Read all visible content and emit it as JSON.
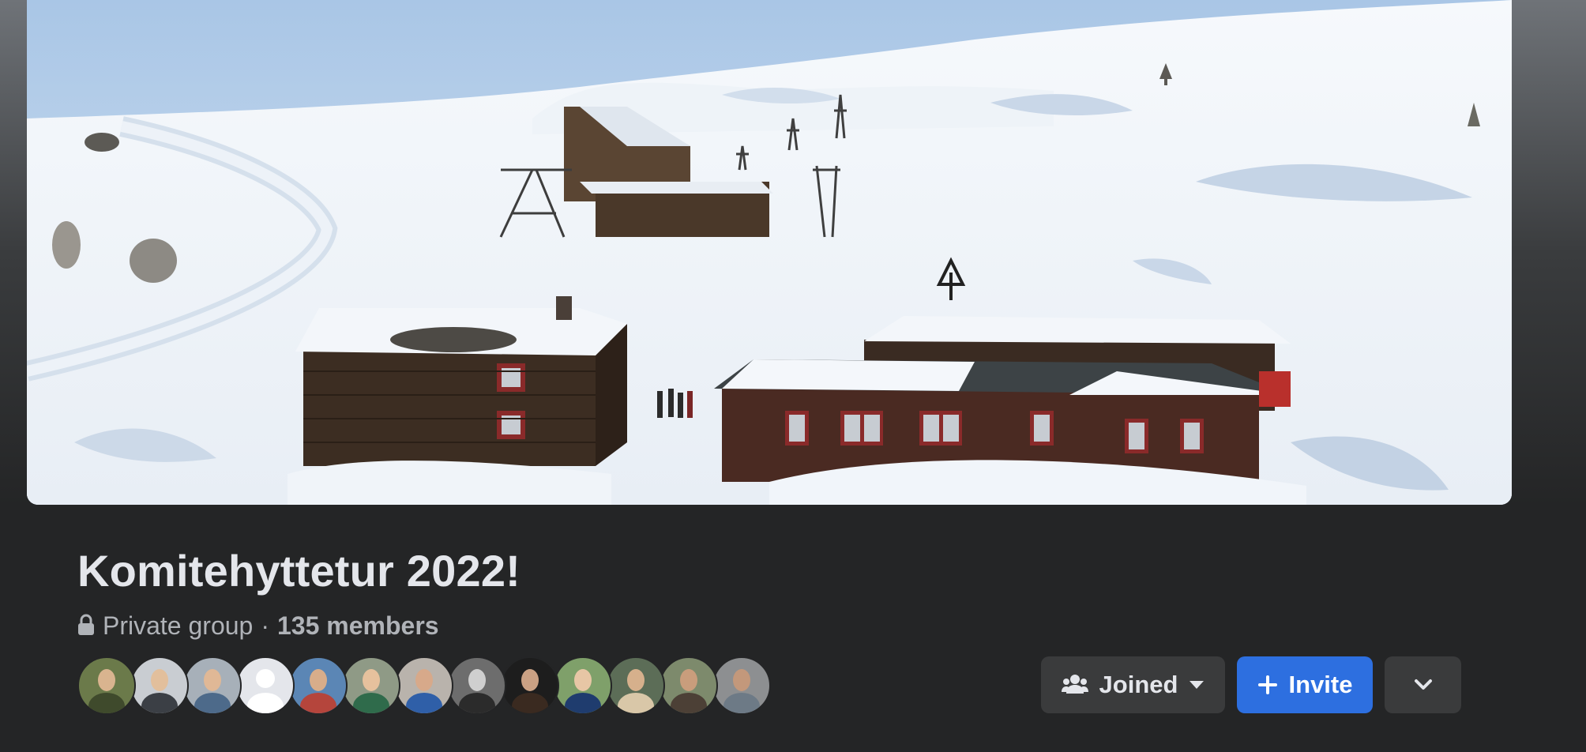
{
  "group": {
    "title": "Komitehyttetur 2022!",
    "privacy": "Private group",
    "separator": "·",
    "members": "135 members"
  },
  "cover": {
    "icon": "cover-photo",
    "description": "snowy-mountain-cabins"
  },
  "actions": {
    "joined_label": "Joined",
    "invite_label": "Invite",
    "joined_icon": "people-icon",
    "joined_caret": "caret-down-icon",
    "invite_icon": "plus-icon",
    "more_icon": "chevron-down-icon"
  },
  "member_avatars": [
    {
      "bg": "#6b7a4a",
      "face": "#d9b48f",
      "body": "#3f4a2c"
    },
    {
      "bg": "#c9cdd2",
      "face": "#e2bf9c",
      "body": "#3b3f45"
    },
    {
      "bg": "#a7b0b9",
      "face": "#e0b896",
      "body": "#4d6a8a"
    },
    {
      "bg": "#e4e6eb",
      "face": "#ffffff",
      "body": "#ffffff"
    },
    {
      "bg": "#5b86b5",
      "face": "#d8ad8a",
      "body": "#b5453c"
    },
    {
      "bg": "#8f9a86",
      "face": "#e6c19d",
      "body": "#2f6b4b"
    },
    {
      "bg": "#b9b3ac",
      "face": "#d7a98a",
      "body": "#2f5fa8"
    },
    {
      "bg": "#6d6d6d",
      "face": "#cfcfcf",
      "body": "#2b2b2b"
    },
    {
      "bg": "#1d1d1d",
      "face": "#caa184",
      "body": "#3a2a20"
    },
    {
      "bg": "#7fa06a",
      "face": "#e7c6a5",
      "body": "#1f3c6e"
    },
    {
      "bg": "#5c6d57",
      "face": "#d6b08c",
      "body": "#d9c7a8"
    },
    {
      "bg": "#7d8a6c",
      "face": "#c99d7c",
      "body": "#4c4036"
    },
    {
      "bg": "#8d8f91",
      "face": "#c3987b",
      "body": "#6d7a86"
    }
  ]
}
